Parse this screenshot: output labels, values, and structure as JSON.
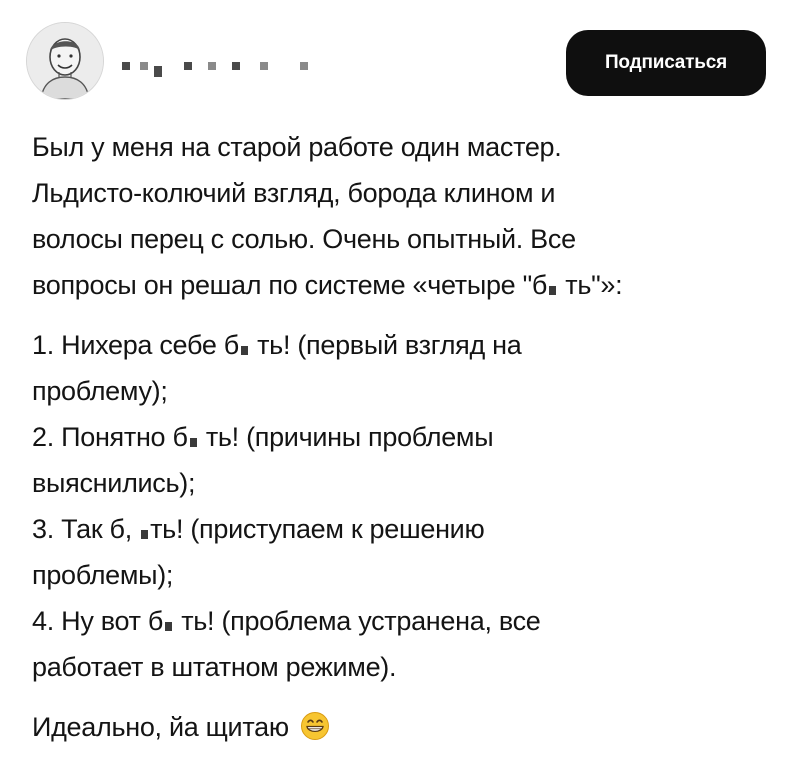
{
  "header": {
    "subscribe_label": "Подписаться"
  },
  "post": {
    "intro": [
      "Был у меня на старой работе один мастер.",
      "Льдисто-колючий взгляд, борода клином и",
      "волосы перец с солью. Очень опытный. Все",
      "вопросы он решал по системе «четыре \"б",
      "ть\"»:"
    ],
    "items": [
      {
        "a": "1. Нихера себе б",
        "b": " ть! (первый взгляд на",
        "c": "проблему);"
      },
      {
        "a": "2. Понятно б",
        "b": " ть! (причины проблемы",
        "c": "выяснились);"
      },
      {
        "a": "3. Так б,",
        "b": "ть! (приступаем к решению",
        "c": "проблемы);"
      },
      {
        "a": "4. Ну вот б",
        "b": " ть! (проблема устранена, все",
        "c": "работает в штатном режиме)."
      }
    ],
    "closing": "Идеально, йа щитаю",
    "emoji_icon": "grinning-face-emoji"
  }
}
